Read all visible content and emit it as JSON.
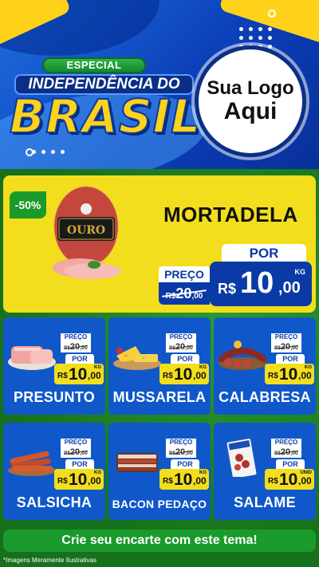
{
  "header": {
    "especial": "ESPECIAL",
    "title": "INDEPENDÊNCIA DO",
    "brasil": "BRASIL",
    "logo_line1": "Sua Logo",
    "logo_line2": "Aqui"
  },
  "hero": {
    "discount": "-50%",
    "name": "MORTADELA",
    "preco_label": "PREÇO",
    "old_currency": "R$",
    "old_int": "20",
    "old_dec": ",00",
    "por_label": "POR",
    "currency": "R$",
    "price_int": "10",
    "price_dec": ",00",
    "unit": "KG",
    "product_brand": "OURO"
  },
  "products": [
    {
      "name": "PRESUNTO",
      "preco_label": "PREÇO",
      "old_currency": "R$",
      "old_int": "20",
      "old_dec": ",00",
      "por_label": "POR",
      "currency": "R$",
      "price_int": "10",
      "price_dec": ",00",
      "unit": "KG"
    },
    {
      "name": "MUSSARELA",
      "preco_label": "PREÇO",
      "old_currency": "R$",
      "old_int": "20",
      "old_dec": ",00",
      "por_label": "POR",
      "currency": "R$",
      "price_int": "10",
      "price_dec": ",00",
      "unit": "KG"
    },
    {
      "name": "CALABRESA",
      "preco_label": "PREÇO",
      "old_currency": "R$",
      "old_int": "20",
      "old_dec": ",00",
      "por_label": "POR",
      "currency": "R$",
      "price_int": "10",
      "price_dec": ",00",
      "unit": "KG"
    },
    {
      "name": "SALSICHA",
      "preco_label": "PREÇO",
      "old_currency": "R$",
      "old_int": "20",
      "old_dec": ",00",
      "por_label": "POR",
      "currency": "R$",
      "price_int": "10",
      "price_dec": ",00",
      "unit": "KG"
    },
    {
      "name": "BACON PEDAÇO",
      "preco_label": "PREÇO",
      "old_currency": "R$",
      "old_int": "20",
      "old_dec": ",00",
      "por_label": "POR",
      "currency": "R$",
      "price_int": "10",
      "price_dec": ",00",
      "unit": "KG"
    },
    {
      "name": "SALAME",
      "preco_label": "PREÇO",
      "old_currency": "R$",
      "old_int": "20",
      "old_dec": ",00",
      "por_label": "POR",
      "currency": "R$",
      "price_int": "10",
      "price_dec": ",00",
      "unit": "UNID"
    }
  ],
  "footer": {
    "cta": "Crie seu encarte com este tema!",
    "disclaimer": "*Imagens Meramente Ilustrativas"
  },
  "colors": {
    "blue": "#0a3aa6",
    "card_blue": "#1058c9",
    "yellow": "#f2de1c",
    "green": "#1b9a2c",
    "background_green": "#17701b"
  }
}
